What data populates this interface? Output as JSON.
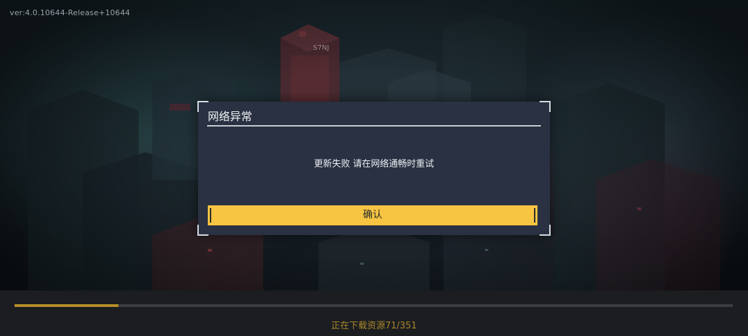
{
  "version_text": "ver:4.0.10644-Release+10644",
  "building_sign": "S7NJ",
  "dialog": {
    "title": "网络异常",
    "message": "更新失败  请在网络通畅时重试",
    "confirm_label": "确认"
  },
  "progress": {
    "text": "正在下载资源71/351",
    "current": 71,
    "total": 351,
    "fill_fraction": 0.145
  },
  "colors": {
    "dialog_bg": "#2a3142",
    "button_bg": "#f7c542",
    "progress_fill": "#b78f2a",
    "progress_text": "#a8862b"
  }
}
